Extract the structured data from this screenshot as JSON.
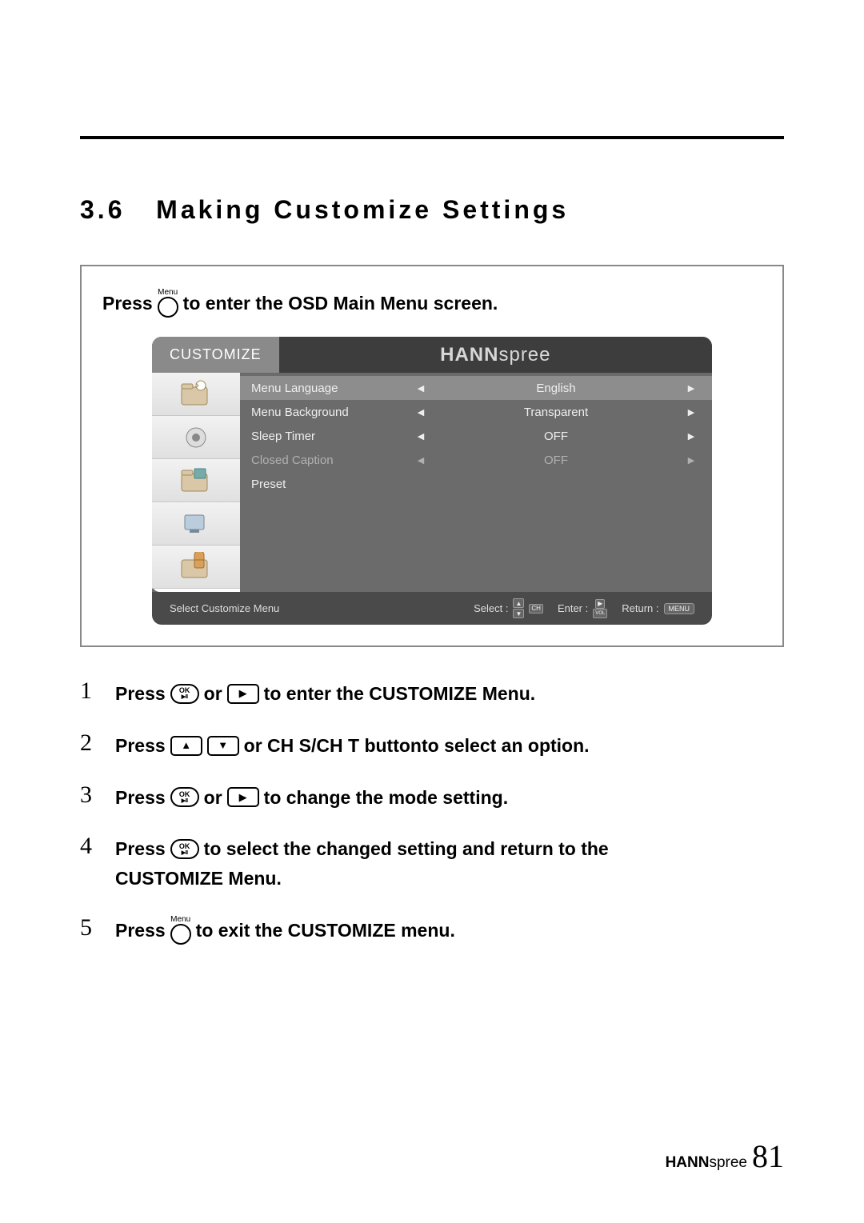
{
  "section": {
    "number": "3.6",
    "title": "Making Customize Settings"
  },
  "intro": {
    "press": "Press",
    "to_enter": "to enter the OSD Main Menu screen.",
    "menu_label": "Menu"
  },
  "osd": {
    "tab": "CUSTOMIZE",
    "brand_bold": "HANN",
    "brand_thin": "spree",
    "rows": [
      {
        "label": "Menu Language",
        "value": "English",
        "selected": true,
        "dim": false,
        "arrows": true
      },
      {
        "label": "Menu Background",
        "value": "Transparent",
        "selected": false,
        "dim": false,
        "arrows": true
      },
      {
        "label": "Sleep Timer",
        "value": "OFF",
        "selected": false,
        "dim": false,
        "arrows": true
      },
      {
        "label": "Closed Caption",
        "value": "OFF",
        "selected": false,
        "dim": true,
        "arrows": true
      },
      {
        "label": "Preset",
        "value": "",
        "selected": false,
        "dim": false,
        "arrows": false
      }
    ],
    "hints": {
      "status": "Select Customize Menu",
      "select": "Select :",
      "enter": "Enter :",
      "return": "Return :",
      "ch": "CH",
      "vol": "VOL",
      "menu": "MENU"
    }
  },
  "steps": [
    {
      "n": "1",
      "parts": [
        "Press",
        "OK",
        "or",
        "RIGHT",
        "to enter the CUSTOMIZE Menu."
      ]
    },
    {
      "n": "2",
      "parts": [
        "Press",
        "UP",
        "DOWN",
        "or",
        "CH S/CH T",
        "buttonto select an option."
      ]
    },
    {
      "n": "3",
      "parts": [
        "Press",
        "OK",
        "or",
        "RIGHT",
        "to change the mode setting."
      ]
    },
    {
      "n": "4",
      "parts": [
        "Press",
        "OK",
        "to select the changed setting and return to the CUSTOMIZE Menu."
      ]
    },
    {
      "n": "5",
      "parts": [
        "Press",
        "MENU",
        "to exit the CUSTOMIZE menu."
      ]
    }
  ],
  "step_text": {
    "press": "Press",
    "or": "or",
    "s1_tail": "to enter the CUSTOMIZE Menu.",
    "s2_mid": "or CH S/CH T buttonto select an option.",
    "s3_tail": "to change the mode setting.",
    "s4_tail_a": "to select the changed setting and return to the",
    "s4_tail_b": "CUSTOMIZE Menu.",
    "s5_tail": "to exit the CUSTOMIZE menu."
  },
  "footer": {
    "brand_bold": "HANN",
    "brand_thin": "spree",
    "page": "81"
  }
}
